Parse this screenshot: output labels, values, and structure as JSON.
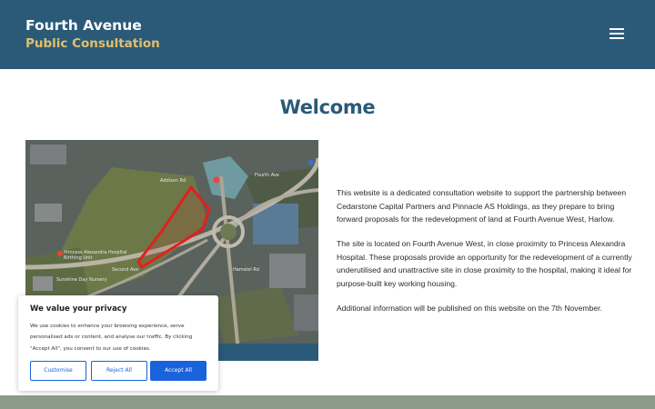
{
  "header": {
    "title_line1": "Fourth Avenue",
    "title_line2": "Public Consultation",
    "menu_icon": "hamburger-menu-icon",
    "background_color": "#2a5a78",
    "accent_color": "#e4bf6a"
  },
  "main": {
    "heading": "Welcome",
    "map": {
      "labels": {
        "addison": "Addison Rd",
        "hospital": "Princess Alexandra Hospital Birthing Unit",
        "nursery": "Sunshine Day Nursery",
        "fourth_ave": "Fourth Ave",
        "hamstel": "Hamstel Rd",
        "second_ave": "Second Ave"
      }
    },
    "paragraphs": [
      "This website is a dedicated consultation website to support the partnership between Cedarstone Capital Partners and Pinnacle AS Holdings, as they prepare to bring forward proposals for the redevelopment of land at Fourth Avenue West, Harlow.",
      "The site is located on Fourth Avenue West, in close proximity to Princess Alexandra Hospital. These proposals provide an opportunity for the redevelopment of a currently underutilised and unattractive site in close proximity to the hospital, making it ideal for purpose-built key working housing.",
      "Additional information will be published on this website on the 7th November."
    ]
  },
  "cookie_banner": {
    "title": "We value your privacy",
    "body": "We use cookies to enhance your browsing experience, serve personalised ads or content, and analyse our traffic. By clicking \"Accept All\", you consent to our use of cookies.",
    "customise_label": "Customise",
    "reject_label": "Reject All",
    "accept_label": "Accept All",
    "button_color": "#1863dc"
  }
}
